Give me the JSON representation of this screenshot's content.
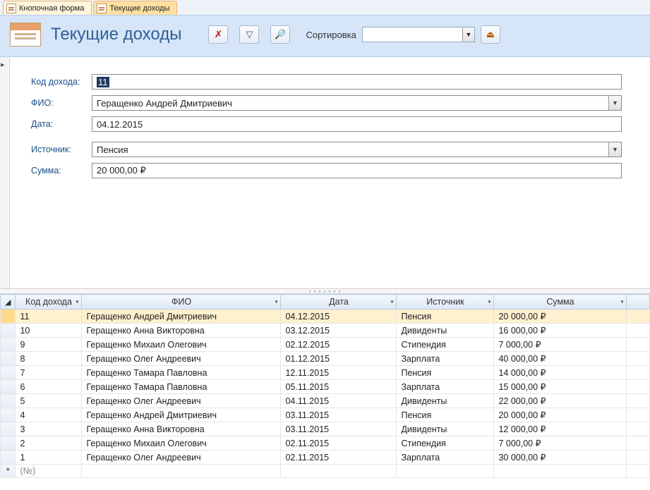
{
  "tabs": [
    {
      "label": "Кнопочная форма",
      "active": false
    },
    {
      "label": "Текущие доходы",
      "active": true
    }
  ],
  "header": {
    "title": "Текущие доходы",
    "sort_label": "Сортировка",
    "sort_value": "",
    "buttons": {
      "clear_filter_glyph": "✗",
      "filter_glyph": "▽",
      "find_glyph": "🔎",
      "close_glyph": "⏏"
    }
  },
  "detail": {
    "labels": {
      "id": "Код дохода:",
      "fio": "ФИО:",
      "date": "Дата:",
      "source": "Источник:",
      "sum": "Сумма:"
    },
    "values": {
      "id": "11",
      "fio": "Геращенко Андрей Дмитриевич",
      "date": "04.12.2015",
      "source": "Пенсия",
      "sum": "20 000,00 ₽"
    }
  },
  "grid": {
    "columns": [
      "Код дохода",
      "ФИО",
      "Дата",
      "Источник",
      "Сумма"
    ],
    "new_row_placeholder": "(№)",
    "rows": [
      {
        "id": "11",
        "fio": "Геращенко Андрей Дмитриевич",
        "date": "04.12.2015",
        "source": "Пенсия",
        "sum": "20 000,00 ₽",
        "selected": true
      },
      {
        "id": "10",
        "fio": "Геращенко Анна Викторовна",
        "date": "03.12.2015",
        "source": "Дивиденты",
        "sum": "16 000,00 ₽"
      },
      {
        "id": "9",
        "fio": "Геращенко Михаил Олегович",
        "date": "02.12.2015",
        "source": "Стипендия",
        "sum": "7 000,00 ₽"
      },
      {
        "id": "8",
        "fio": "Геращенко Олег Андреевич",
        "date": "01.12.2015",
        "source": "Зарплата",
        "sum": "40 000,00 ₽"
      },
      {
        "id": "7",
        "fio": "Геращенко Тамара Павловна",
        "date": "12.11.2015",
        "source": "Пенсия",
        "sum": "14 000,00 ₽"
      },
      {
        "id": "6",
        "fio": "Геращенко Тамара Павловна",
        "date": "05.11.2015",
        "source": "Зарплата",
        "sum": "15 000,00 ₽"
      },
      {
        "id": "5",
        "fio": "Геращенко Олег Андреевич",
        "date": "04.11.2015",
        "source": "Дивиденты",
        "sum": "22 000,00 ₽"
      },
      {
        "id": "4",
        "fio": "Геращенко Андрей Дмитриевич",
        "date": "03.11.2015",
        "source": "Пенсия",
        "sum": "20 000,00 ₽"
      },
      {
        "id": "3",
        "fio": "Геращенко Анна Викторовна",
        "date": "03.11.2015",
        "source": "Дивиденты",
        "sum": "12 000,00 ₽"
      },
      {
        "id": "2",
        "fio": "Геращенко Михаил Олегович",
        "date": "02.11.2015",
        "source": "Стипендия",
        "sum": "7 000,00 ₽"
      },
      {
        "id": "1",
        "fio": "Геращенко Олег Андреевич",
        "date": "02.11.2015",
        "source": "Зарплата",
        "sum": "30 000,00 ₽"
      }
    ]
  }
}
